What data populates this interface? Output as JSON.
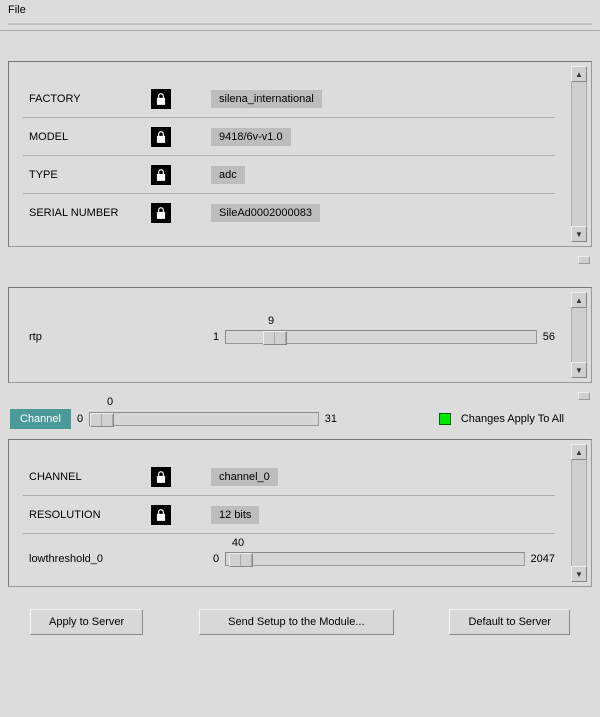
{
  "menu": {
    "file": "File"
  },
  "device": {
    "rows": [
      {
        "label": "FACTORY",
        "value": "silena_international"
      },
      {
        "label": "MODEL",
        "value": "9418/6v-v1.0"
      },
      {
        "label": "TYPE",
        "value": "adc"
      },
      {
        "label": "SERIAL NUMBER",
        "value": "SileAd0002000083"
      }
    ]
  },
  "rtp": {
    "label": "rtp",
    "min": "1",
    "max": "56",
    "value": "9"
  },
  "channel_selector": {
    "label": "Channel",
    "min": "0",
    "max": "31",
    "value": "0",
    "apply_all": "Changes Apply To All"
  },
  "channel_props": {
    "rows": [
      {
        "label": "CHANNEL",
        "value": "channel_0"
      },
      {
        "label": "RESOLUTION",
        "value": "12 bits"
      }
    ],
    "slider": {
      "label": "lowthreshold_0",
      "min": "0",
      "max": "2047",
      "value": "40"
    }
  },
  "buttons": {
    "apply": "Apply to Server",
    "send": "Send Setup to the Module...",
    "default": "Default to Server"
  }
}
